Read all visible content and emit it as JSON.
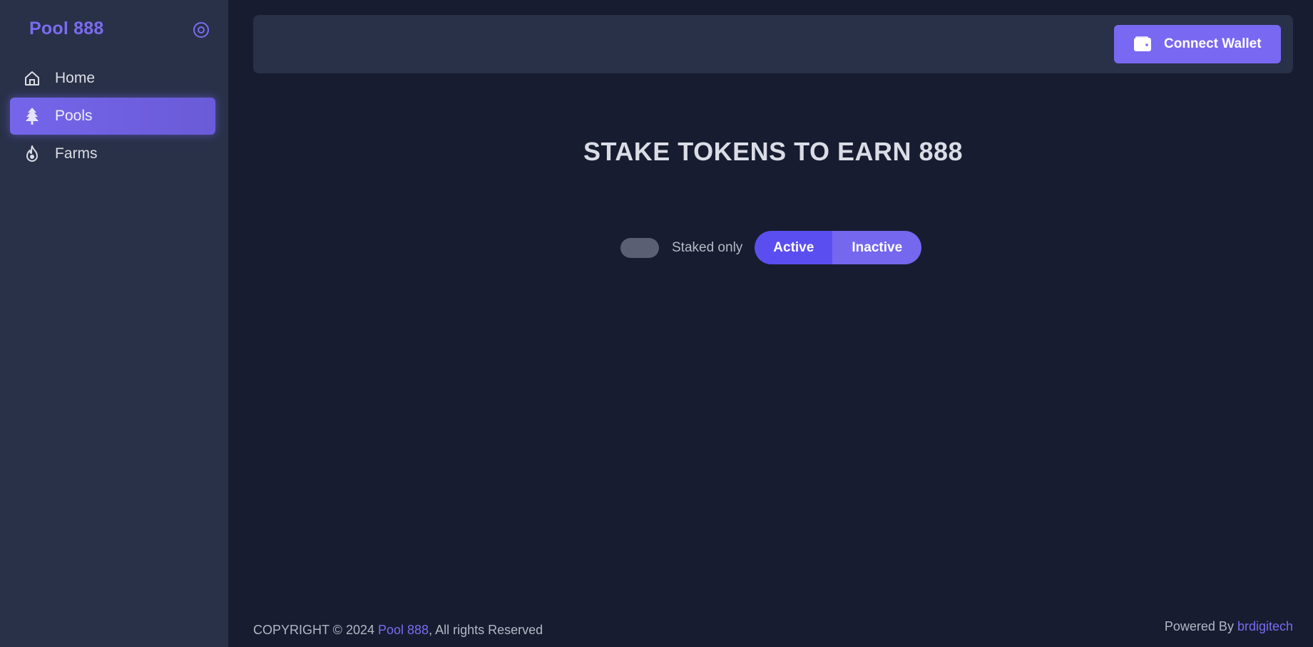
{
  "brand": {
    "name": "Pool 888"
  },
  "sidebar": {
    "items": [
      {
        "label": "Home",
        "icon": "home-icon",
        "active": false
      },
      {
        "label": "Pools",
        "icon": "tree-icon",
        "active": true
      },
      {
        "label": "Farms",
        "icon": "flame-icon",
        "active": false
      }
    ]
  },
  "topbar": {
    "connect_label": "Connect Wallet"
  },
  "main": {
    "headline": "STAKE TOKENS TO EARN 888",
    "staked_only_label": "Staked only",
    "staked_only_on": false,
    "tabs": [
      {
        "label": "Active",
        "selected": true
      },
      {
        "label": "Inactive",
        "selected": false
      }
    ]
  },
  "footer": {
    "copyright_prefix": "COPYRIGHT © 2024 ",
    "copyright_link": "Pool 888",
    "copyright_suffix": ", All rights Reserved",
    "powered_prefix": "Powered By ",
    "powered_link": "brdigitech"
  },
  "colors": {
    "accent": "#7868f2",
    "background": "#171c30",
    "panel": "#293149",
    "tab_active": "#5b4ef0",
    "tab_inactive": "#7567ee"
  }
}
